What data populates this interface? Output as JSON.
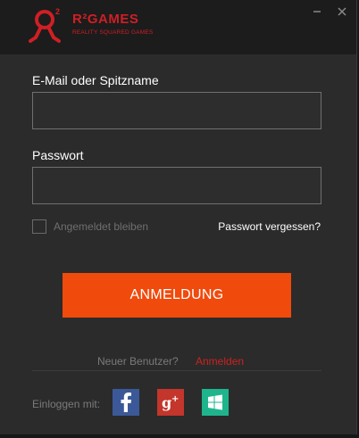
{
  "window": {
    "controls": {
      "minimize_icon": "minimize-icon",
      "close_icon": "close-icon"
    }
  },
  "logo": {
    "brand": "R²GAMES",
    "tagline": "REALITY SQUARED GAMES",
    "color": "#cf1f25"
  },
  "form": {
    "email_label": "E-Mail oder Spitzname",
    "email_value": "",
    "password_label": "Passwort",
    "password_value": "",
    "remember_label": "Angemeldet bleiben",
    "remember_checked": false,
    "forgot_label": "Passwort vergessen?",
    "login_button": "ANMELDUNG",
    "accent_color": "#f04a0c"
  },
  "footer": {
    "new_user_label": "Neuer Benutzer?",
    "register_link": "Anmelden",
    "login_with_label": "Einloggen mit:",
    "social": [
      {
        "icon": "facebook-icon",
        "color": "#3b5998"
      },
      {
        "icon": "google-plus-icon",
        "color": "#c4352b"
      },
      {
        "icon": "windows-icon",
        "color": "#1fb58c"
      }
    ]
  }
}
